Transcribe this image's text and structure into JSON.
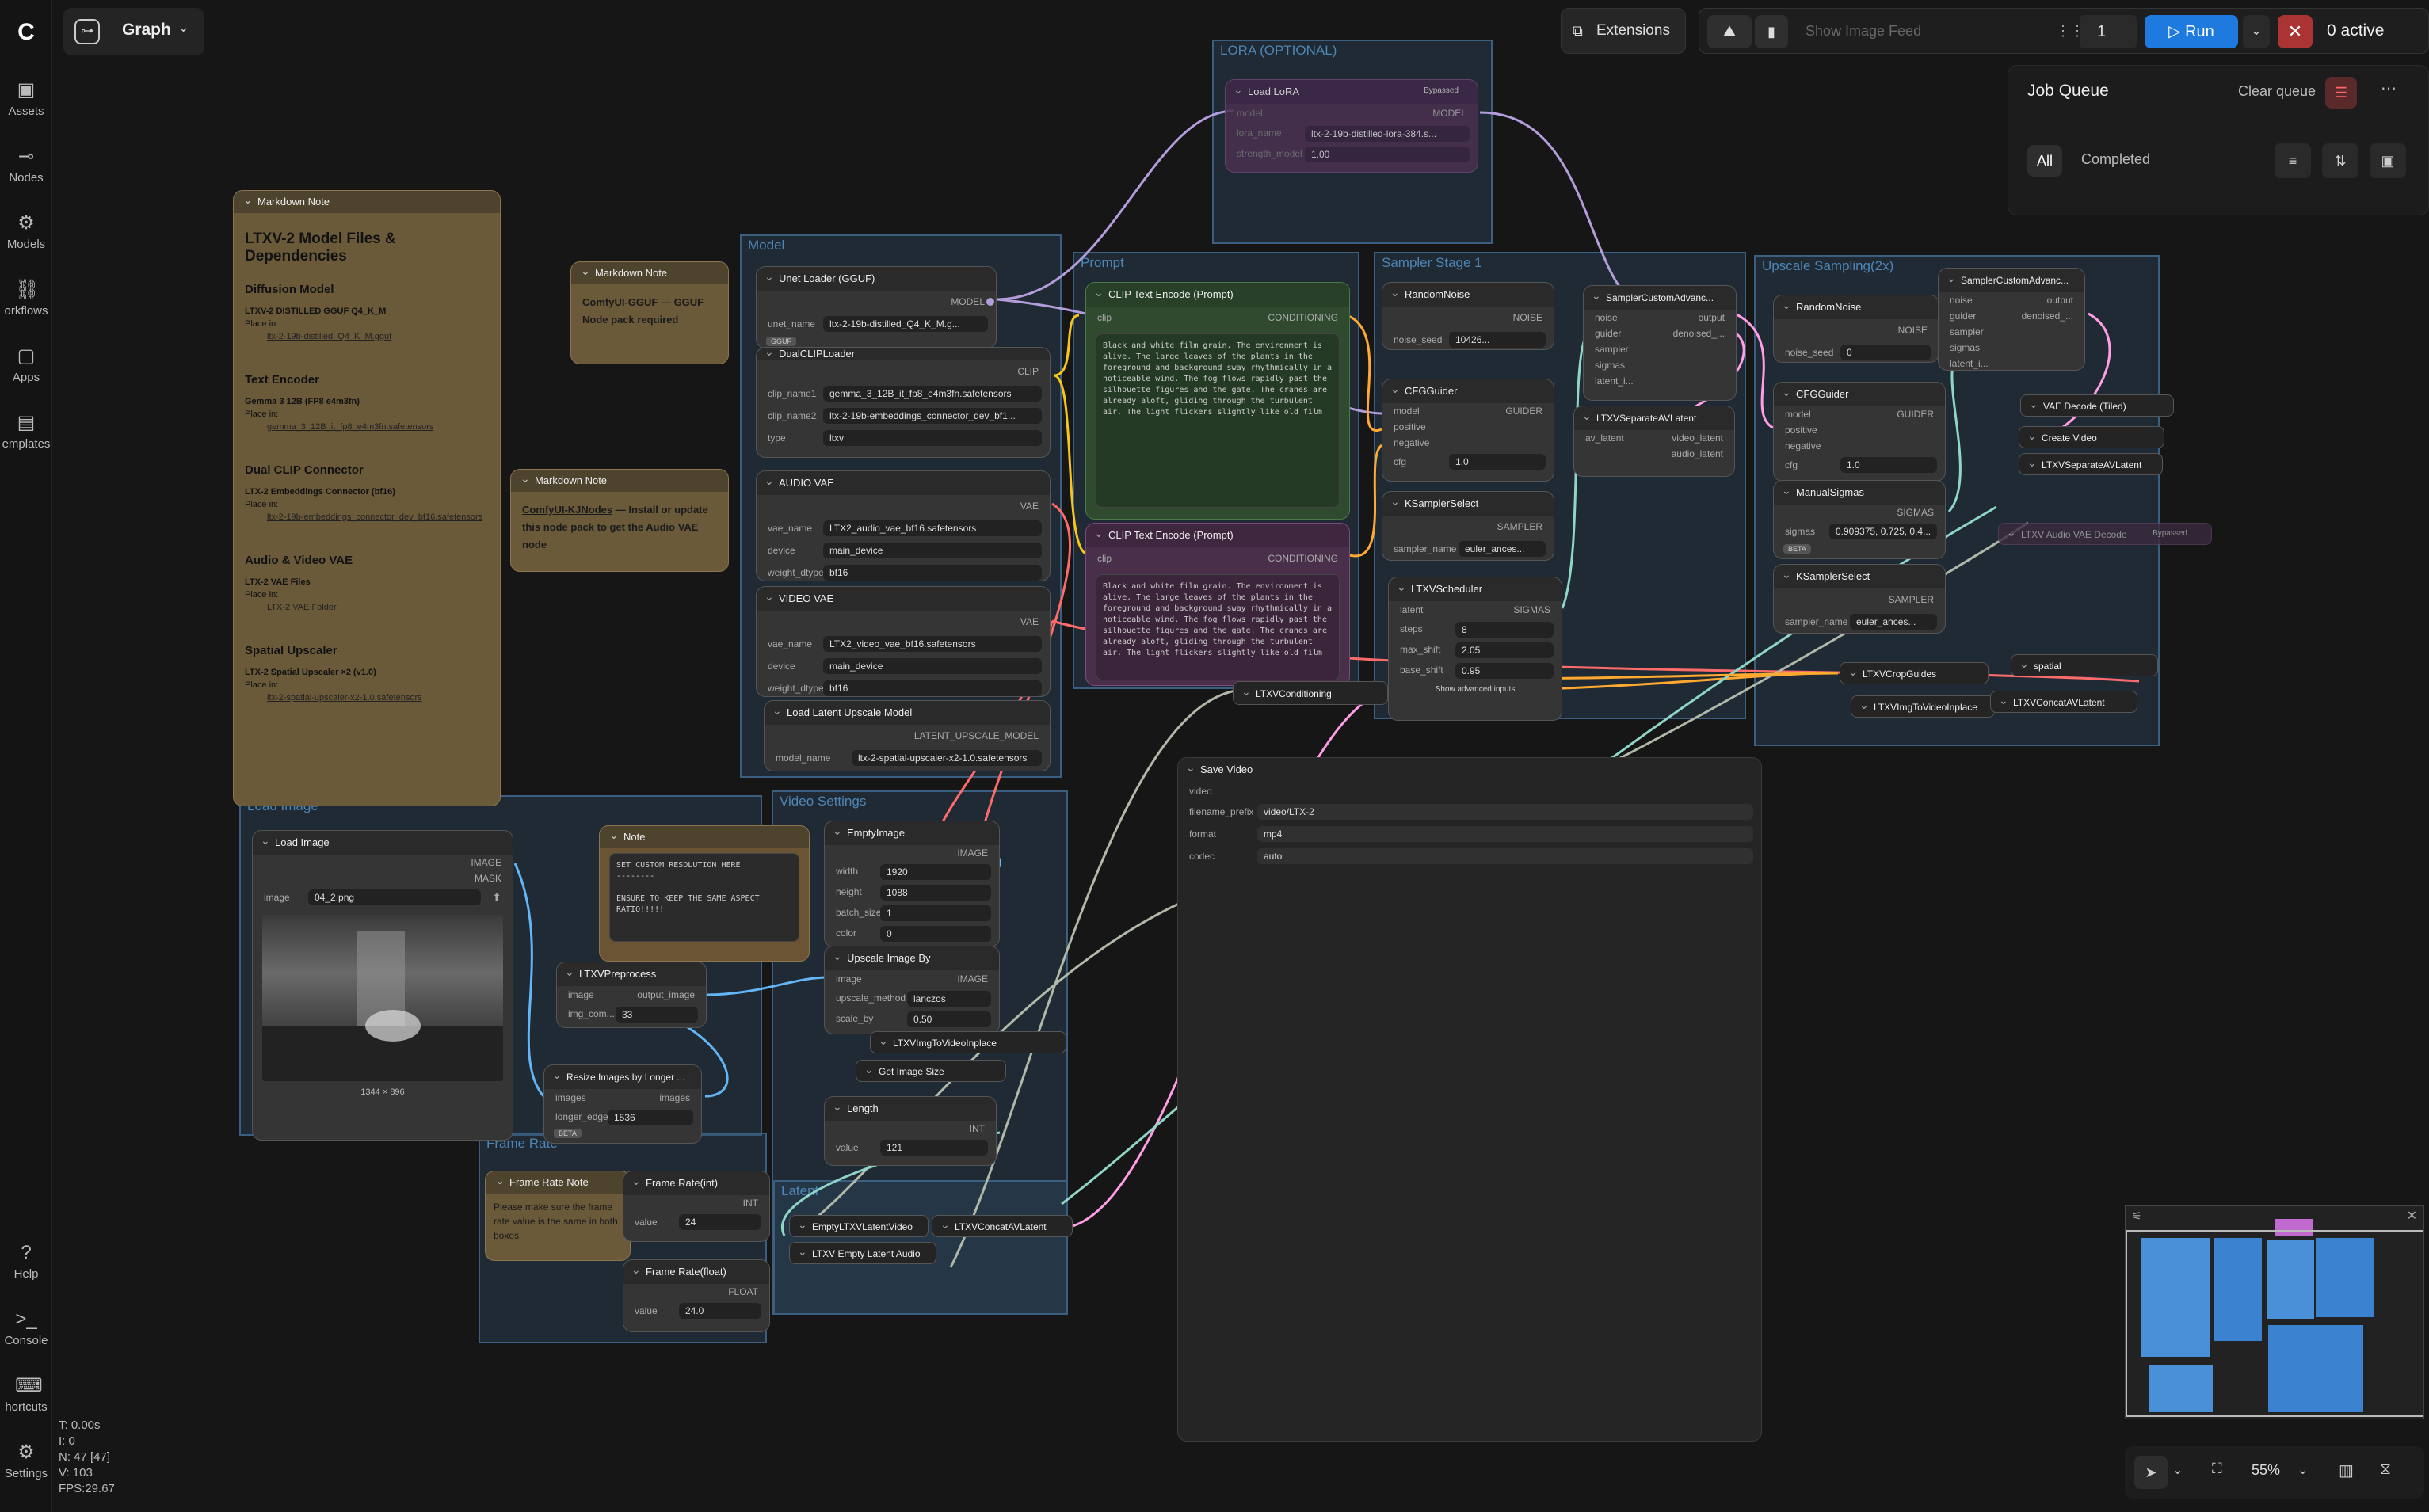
{
  "app": {
    "graph_label": "Graph",
    "logo": "C"
  },
  "sidebar": {
    "items": [
      {
        "label": "Assets",
        "icon": "image-icon"
      },
      {
        "label": "Nodes",
        "icon": "nodes-icon"
      },
      {
        "label": "Models",
        "icon": "models-icon"
      },
      {
        "label": "orkflows",
        "icon": "workflows-icon"
      },
      {
        "label": "Apps",
        "icon": "apps-icon"
      },
      {
        "label": "emplates",
        "icon": "templates-icon"
      }
    ],
    "bottom": [
      {
        "label": "Help"
      },
      {
        "label": "Console"
      },
      {
        "label": "hortcuts"
      },
      {
        "label": "Settings"
      }
    ]
  },
  "topbar": {
    "extensions": "Extensions",
    "show_feed": "Show Image Feed",
    "batch": "1",
    "run": "Run",
    "active": "0 active"
  },
  "jobqueue": {
    "title": "Job Queue",
    "clear": "Clear queue",
    "tab_all": "All",
    "tab_completed": "Completed"
  },
  "stats": {
    "t": "T: 0.00s",
    "i": "I: 0",
    "n": "N: 47 [47]",
    "v": "V: 103",
    "fps": "FPS:29.67"
  },
  "zoom": {
    "value": "55%"
  },
  "groups": {
    "lora": "LORA (OPTIONAL)",
    "model": "Model",
    "prompt": "Prompt",
    "sampler1": "Sampler Stage 1",
    "upscale": "Upscale Sampling(2x)",
    "video_settings": "Video Settings",
    "frame_rate": "Frame Rate",
    "latent": "Latent",
    "load_image": "Load Image"
  },
  "nodes": {
    "md1_title": "Markdown Note",
    "md1_h": "LTXV-2 Model Files & Dependencies",
    "md1_s1": "Diffusion Model",
    "md1_s1a": "LTXV-2 DISTILLED GGUF Q4_K_M",
    "md1_s1l": "ltx-2-19b-distilled_Q4_K_M.gguf",
    "md1_s2": "Text Encoder",
    "md1_s2a": "Gemma 3 12B (FP8 e4m3fn)",
    "md1_s2l": "gemma_3_12B_it_fp8_e4m3fn.safetensors",
    "md1_s3": "Dual CLIP Connector",
    "md1_s3a": "LTX-2 Embeddings Connector (bf16)",
    "md1_s3l": "ltx-2-19b-embeddings_connector_dev_bf16.safetensors",
    "md1_s4": "Audio & Video VAE",
    "md1_s4a": "LTX-2 VAE Files",
    "md1_s4l": "LTX-2 VAE Folder",
    "md1_s5": "Spatial Upscaler",
    "md1_s5a": "LTX-2 Spatial Upscaler ×2 (v1.0)",
    "md1_s5l": "ltx-2-spatial-upscaler-x2-1.0.safetensors",
    "place_in": "Place in:",
    "md2_title": "Markdown Note",
    "md2_link": "ComfyUI-GGUF",
    "md2_text": " — GGUF Node pack required",
    "md3_title": "Markdown Note",
    "md3_link": "ComfyUI-KJNodes",
    "md3_text": " — Install or update this node pack to get the Audio VAE node",
    "unet_title": "Unet Loader (GGUF)",
    "unet_out": "MODEL",
    "unet_name_l": "unet_name",
    "unet_name": "ltx-2-19b-distilled_Q4_K_M.g...",
    "gguf_badge": "GGUF",
    "dual_title": "DualCLIPLoader",
    "dual_out": "CLIP",
    "clip1_l": "clip_name1",
    "clip1": "gemma_3_12B_it_fp8_e4m3fn.safetensors",
    "clip2_l": "clip_name2",
    "clip2": "ltx-2-19b-embeddings_connector_dev_bf1...",
    "type_l": "type",
    "type": "ltxv",
    "avae_title": "AUDIO VAE",
    "vae_out": "VAE",
    "vae_name_l": "vae_name",
    "avae_name": "LTX2_audio_vae_bf16.safetensors",
    "device_l": "device",
    "device": "main_device",
    "wd_l": "weight_dtype",
    "wd": "bf16",
    "vvae_title": "VIDEO VAE",
    "vvae_name": "LTX2_video_vae_bf16.safetensors",
    "lup_title": "Load Latent Upscale Model",
    "lup_out": "LATENT_UPSCALE_MODEL",
    "lup_model_l": "model_name",
    "lup_model": "ltx-2-spatial-upscaler-x2-1.0.safetensors",
    "lora_title": "Load LoRA",
    "lora_bypass": "Bypassed",
    "lora_model_in": "model",
    "lora_out": "MODEL",
    "lora_name_l": "lora_name",
    "lora_name": "ltx-2-19b-distilled-lora-384.s...",
    "lora_str_l": "strength_model",
    "lora_str": "1.00",
    "clipp_title": "CLIP Text Encode (Prompt)",
    "clip_in": "clip",
    "cond_out": "CONDITIONING",
    "pos_text": "Black and white film grain. The environment is alive. The large leaves of the plants in the foreground and background sway rhythmically in a noticeable wind. The fog flows rapidly past the silhouette figures and the gate. The cranes are already aloft, gliding through the turbulent air. The light flickers slightly like old film",
    "neg_text": "Black and white film grain. The environment is alive. The large leaves of the plants in the foreground and background sway rhythmically in a noticeable wind. The fog flows rapidly past the silhouette figures and the gate. The cranes are already aloft, gliding through the turbulent air. The light flickers slightly like old film",
    "ltxvcond": "LTXVConditioning",
    "rn_title": "RandomNoise",
    "noise_out": "NOISE",
    "seed_l": "noise_seed",
    "seed1": "10426...",
    "seed2": "0",
    "cfg_title": "CFGGuider",
    "cfg_out": "GUIDER",
    "in_model": "model",
    "in_pos": "positive",
    "in_neg": "negative",
    "cfg_l": "cfg",
    "cfg_v": "1.0",
    "ks_title": "KSamplerSelect",
    "ks_out": "SAMPLER",
    "sampler_l": "sampler_name",
    "sampler_v": "euler_ances...",
    "sch_title": "LTXVScheduler",
    "sch_out": "SIGMAS",
    "sch_latent": "latent",
    "steps_l": "steps",
    "steps": "8",
    "maxs_l": "max_shift",
    "maxs": "2.05",
    "bases_l": "base_shift",
    "bases": "0.95",
    "adv": "Show advanced inputs",
    "sca_title": "SamplerCustomAdvanc...",
    "sca_noise": "noise",
    "sca_guider": "guider",
    "sca_sampler": "sampler",
    "sca_sigmas": "sigmas",
    "sca_latent": "latent_i...",
    "sca_output": "output",
    "sca_den": "denoised_...",
    "sep_title": "LTXVSeparateAVLatent",
    "sep_in": "av_latent",
    "sep_v": "video_latent",
    "sep_a": "audio_latent",
    "ms_title": "ManualSigmas",
    "ms_out": "SIGMAS",
    "ms_l": "sigmas",
    "ms_v": "0.909375, 0.725, 0.4...",
    "beta": "BETA",
    "vaedt": "VAE Decode (Tiled)",
    "createvideo": "Create Video",
    "sep2": "LTXVSeparateAVLatent",
    "avdec": "LTXV Audio VAE Decode",
    "avdec_bypass": "Bypassed",
    "cropg": "LTXVCropGuides",
    "spatial": "spatial",
    "img2vid": "LTXVImgToVideoInplace",
    "concat": "LTXVConcatAVLatent",
    "save_title": "Save Video",
    "save_in": "video",
    "fp_l": "filename_prefix",
    "fp": "video/LTX-2",
    "format_l": "format",
    "format": "mp4",
    "codec_l": "codec",
    "codec": "auto",
    "li_title": "Load Image",
    "li_image": "IMAGE",
    "li_mask": "MASK",
    "li_l": "image",
    "li_v": "04_2.png",
    "li_dims": "1344 × 896",
    "note_title": "Note",
    "note_text": "SET CUSTOM RESOLUTION HERE\n--------\n\nENSURE TO KEEP THE SAME ASPECT RATIO!!!!!",
    "ei_title": "EmptyImage",
    "ei_out": "IMAGE",
    "w_l": "width",
    "w": "1920",
    "h_l": "height",
    "h": "1088",
    "bs_l": "batch_size",
    "bs": "1",
    "col_l": "color",
    "col": "0",
    "pre_title": "LTXVPreprocess",
    "pre_in": "image",
    "pre_out": "output_image",
    "pre_c_l": "img_com...",
    "pre_c": "33",
    "uib_title": "Upscale Image By",
    "uib_in": "image",
    "uib_out": "IMAGE",
    "um_l": "upscale_method",
    "um": "lanczos",
    "sb_l": "scale_by",
    "sb": "0.50",
    "itv": "LTXVImgToVideoInplace",
    "gis": "Get Image Size",
    "rs_title": "Resize Images by Longer ...",
    "rs_in": "images",
    "rs_out": "images",
    "le_l": "longer_edge",
    "le": "1536",
    "len_title": "Length",
    "len_out": "INT",
    "len_l": "value",
    "len_v": "121",
    "frn_title": "Frame Rate Note",
    "frn_text": "Please make sure the frame rate value is the same in both boxes",
    "fri_title": "Frame Rate(int)",
    "fri_out": "INT",
    "fri_l": "value",
    "fri_v": "24",
    "frf_title": "Frame Rate(float)",
    "frf_out": "FLOAT",
    "frf_l": "value",
    "frf_v": "24.0",
    "elv": "EmptyLTXVLatentVideo",
    "ela": "LTXV Empty Latent Audio",
    "concat2": "LTXVConcatAVLatent"
  },
  "colors": {
    "accent": "#1f7ae0",
    "note": "#6b5a3a",
    "group": "#3a5f80",
    "clip_wire": "#f5c518",
    "model_wire": "#b39ddb",
    "vae_wire": "#ff6b6b",
    "image_wire": "#64b5f6",
    "latent_wire": "#ff9ee5",
    "cond_wire": "#ffa931"
  }
}
